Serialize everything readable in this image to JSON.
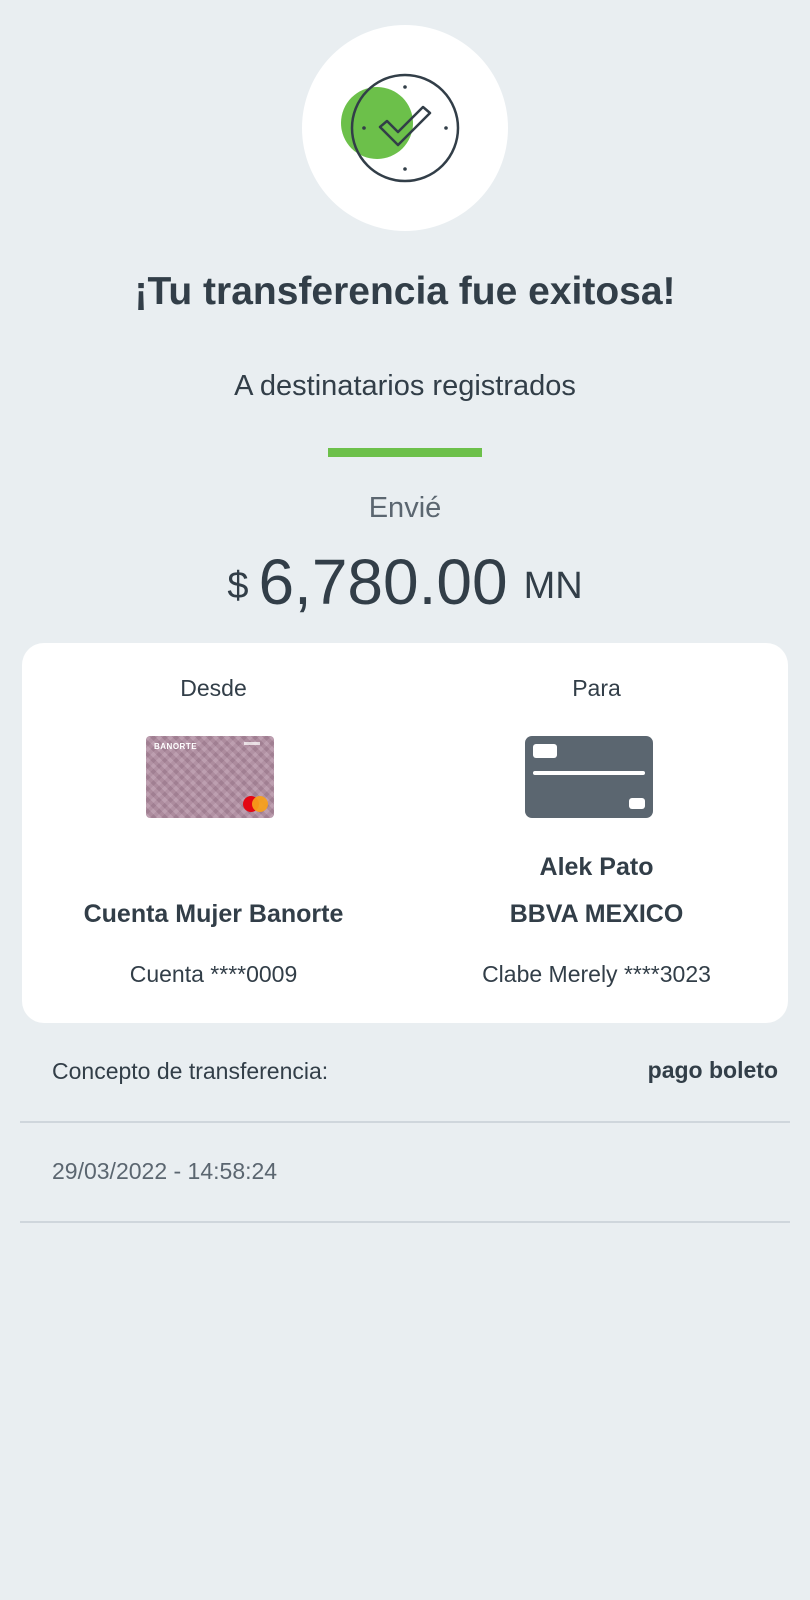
{
  "header": {
    "title": "¡Tu transferencia fue exitosa!",
    "subtitle": "A destinatarios registrados",
    "icon": "success-check-clock-icon",
    "accent_color": "#6cc04a"
  },
  "amount": {
    "label": "Envié",
    "currency_symbol": "$",
    "value": "6,780.00",
    "currency_code": "MN"
  },
  "transfer": {
    "from": {
      "label": "Desde",
      "card_icon": "banorte-card-icon",
      "card_brand": "BANORTE",
      "account_name": "Cuenta Mujer Banorte",
      "account_number": "Cuenta ****0009"
    },
    "to": {
      "label": "Para",
      "card_icon": "generic-card-icon",
      "recipient_name": "Alek Pato",
      "bank_name": "BBVA MEXICO",
      "account_number": "Clabe Merely ****3023"
    }
  },
  "details": {
    "concept_label": "Concepto de transferencia:",
    "concept_value": "pago boleto",
    "datetime": "29/03/2022 - 14:58:24"
  }
}
